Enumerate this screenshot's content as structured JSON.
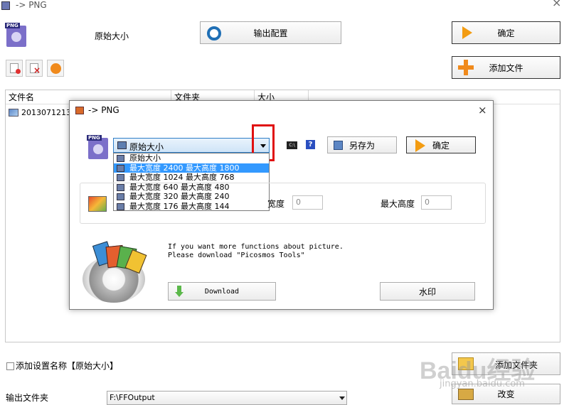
{
  "window": {
    "title": "-> PNG"
  },
  "main": {
    "size_label": "原始大小",
    "output_config_label": "输出配置",
    "ok_label": "确定",
    "add_file_label": "添加文件",
    "columns": [
      "文件名",
      "文件夹",
      "大小"
    ],
    "file_row_name": "201307121303",
    "add_setting_label": "添加设置名称【原始大小】",
    "output_folder_label": "输出文件夹",
    "output_folder_value": "F:\\FFOutput",
    "add_folder_label": "添加文件夹",
    "change_label": "改变"
  },
  "dialog": {
    "title": "-> PNG",
    "close_glyph": "×",
    "preset_selected": "原始大小",
    "preset_options": [
      "原始大小",
      "最大宽度 2400 最大高度 1800",
      "最大宽度 1024 最大高度 768",
      "最大宽度 640 最大高度 480",
      "最大宽度 320 最大高度 240",
      "最大宽度 176 最大高度 144"
    ],
    "save_as_label": "另存为",
    "ok_label": "确定",
    "help_glyph": "?",
    "cmd_glyph": "C:\\",
    "width_label": "宽度",
    "width_value": "0",
    "height_label": "最大高度",
    "height_value": "0",
    "promo_line1": "If you want more functions about picture.",
    "promo_line2": "Please download \"Picosmos Tools\"",
    "download_label": "Download",
    "watermark_label": "水印"
  },
  "watermark": {
    "brand": "Baidu经验",
    "url": "jingyan.baidu.com"
  },
  "colors": {
    "highlight_box": "#e01010",
    "selection": "#3399ff",
    "accent_orange": "#f39c12"
  }
}
